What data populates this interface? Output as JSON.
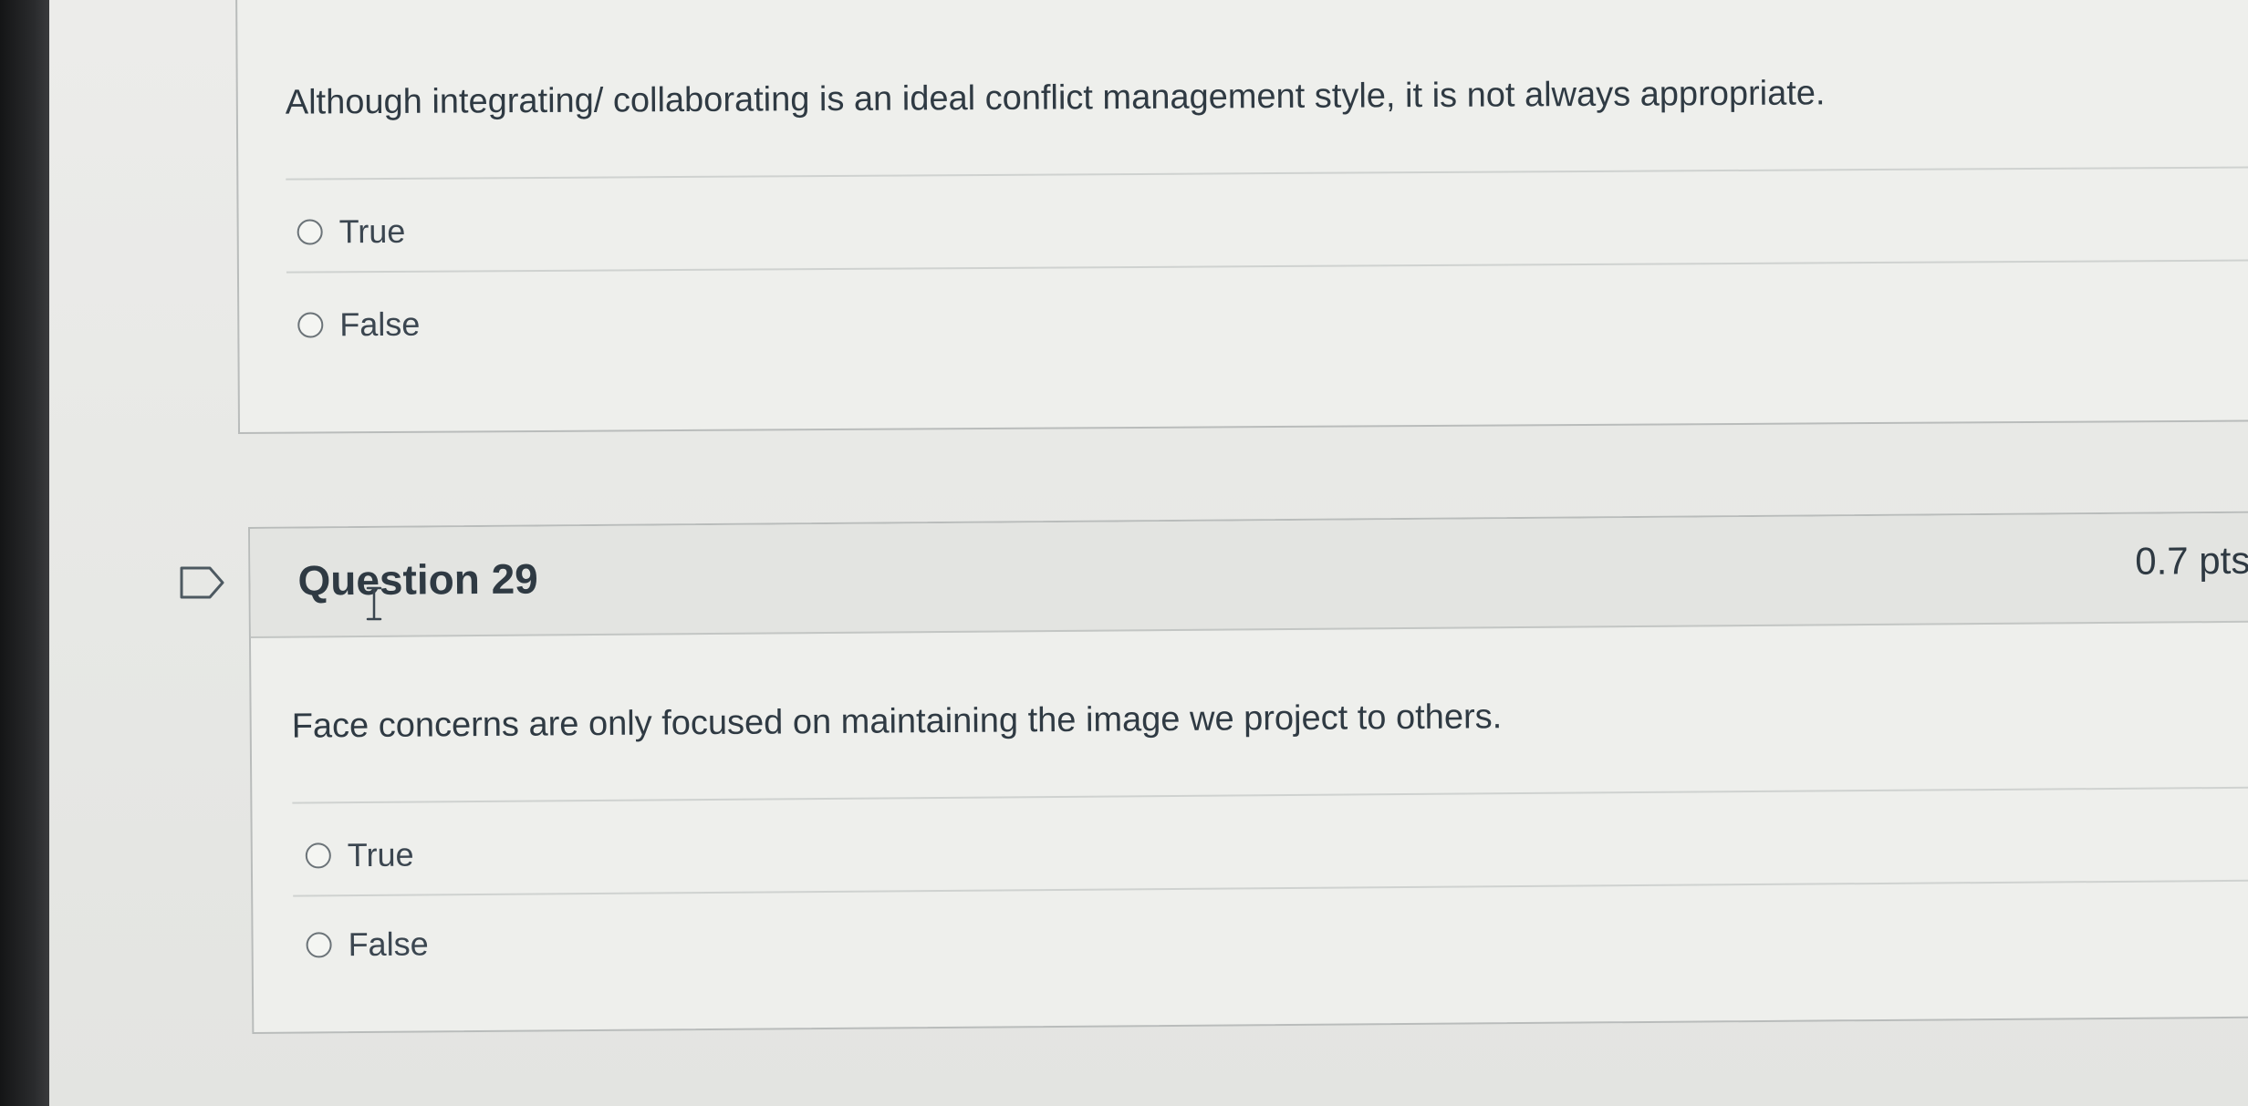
{
  "previous_question": {
    "text": "Although integrating/ collaborating is an ideal conflict management style, it is not always appropriate.",
    "answers": [
      {
        "label": "True"
      },
      {
        "label": "False"
      }
    ]
  },
  "question": {
    "title": "Question 29",
    "points": "0.7 pts",
    "text": "Face concerns are only focused on maintaining the image we project to others.",
    "answers": [
      {
        "label": "True"
      },
      {
        "label": "False"
      }
    ]
  },
  "icons": {
    "flag": "flag-question-icon",
    "radio": "radio-button-icon",
    "cursor": "text-cursor-icon"
  },
  "colors": {
    "background": "#e9eae7",
    "card_border": "#b9bcbb",
    "text": "#2f3a43"
  }
}
